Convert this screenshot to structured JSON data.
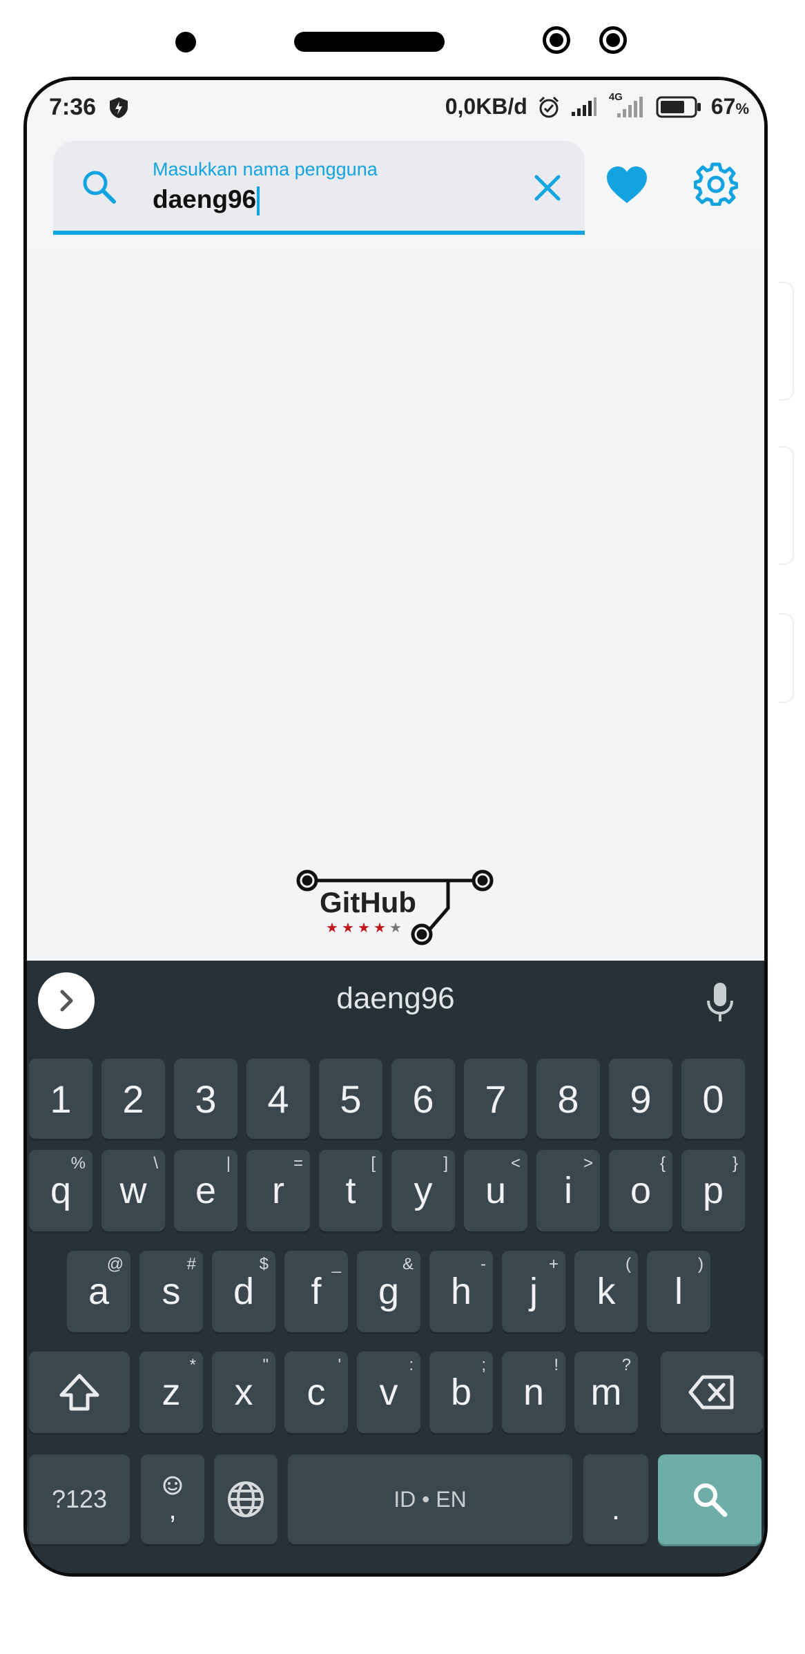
{
  "status_bar": {
    "time": "7:36",
    "network_speed": "0,0KB/d",
    "network_type": "4G",
    "battery": "67",
    "battery_unit": "%"
  },
  "search": {
    "label": "Masukkan nama pengguna",
    "value": "daeng96"
  },
  "logo": {
    "text": "GitHub",
    "stars_filled": 4,
    "stars_total": 5
  },
  "keyboard": {
    "suggestion": "daeng96",
    "number_row": [
      "1",
      "2",
      "3",
      "4",
      "5",
      "6",
      "7",
      "8",
      "9",
      "0"
    ],
    "row1": [
      {
        "key": "q",
        "hint": "%"
      },
      {
        "key": "w",
        "hint": "\\"
      },
      {
        "key": "e",
        "hint": "|"
      },
      {
        "key": "r",
        "hint": "="
      },
      {
        "key": "t",
        "hint": "["
      },
      {
        "key": "y",
        "hint": "]"
      },
      {
        "key": "u",
        "hint": "<"
      },
      {
        "key": "i",
        "hint": ">"
      },
      {
        "key": "o",
        "hint": "{"
      },
      {
        "key": "p",
        "hint": "}"
      }
    ],
    "row2": [
      {
        "key": "a",
        "hint": "@"
      },
      {
        "key": "s",
        "hint": "#"
      },
      {
        "key": "d",
        "hint": "$"
      },
      {
        "key": "f",
        "hint": "_"
      },
      {
        "key": "g",
        "hint": "&"
      },
      {
        "key": "h",
        "hint": "-"
      },
      {
        "key": "j",
        "hint": "+"
      },
      {
        "key": "k",
        "hint": "("
      },
      {
        "key": "l",
        "hint": ")"
      }
    ],
    "row3": [
      {
        "key": "z",
        "hint": "*"
      },
      {
        "key": "x",
        "hint": "\""
      },
      {
        "key": "c",
        "hint": "'"
      },
      {
        "key": "v",
        "hint": ":"
      },
      {
        "key": "b",
        "hint": ";"
      },
      {
        "key": "n",
        "hint": "!"
      },
      {
        "key": "m",
        "hint": "?"
      }
    ],
    "symbols_label": "?123",
    "emoji_comma": ",",
    "space_label": "ID • EN",
    "period": "."
  },
  "colors": {
    "accent": "#13a3e0",
    "keyboard_bg": "#263238",
    "key_bg": "#3b474f",
    "search_key_bg": "#6fada8"
  }
}
